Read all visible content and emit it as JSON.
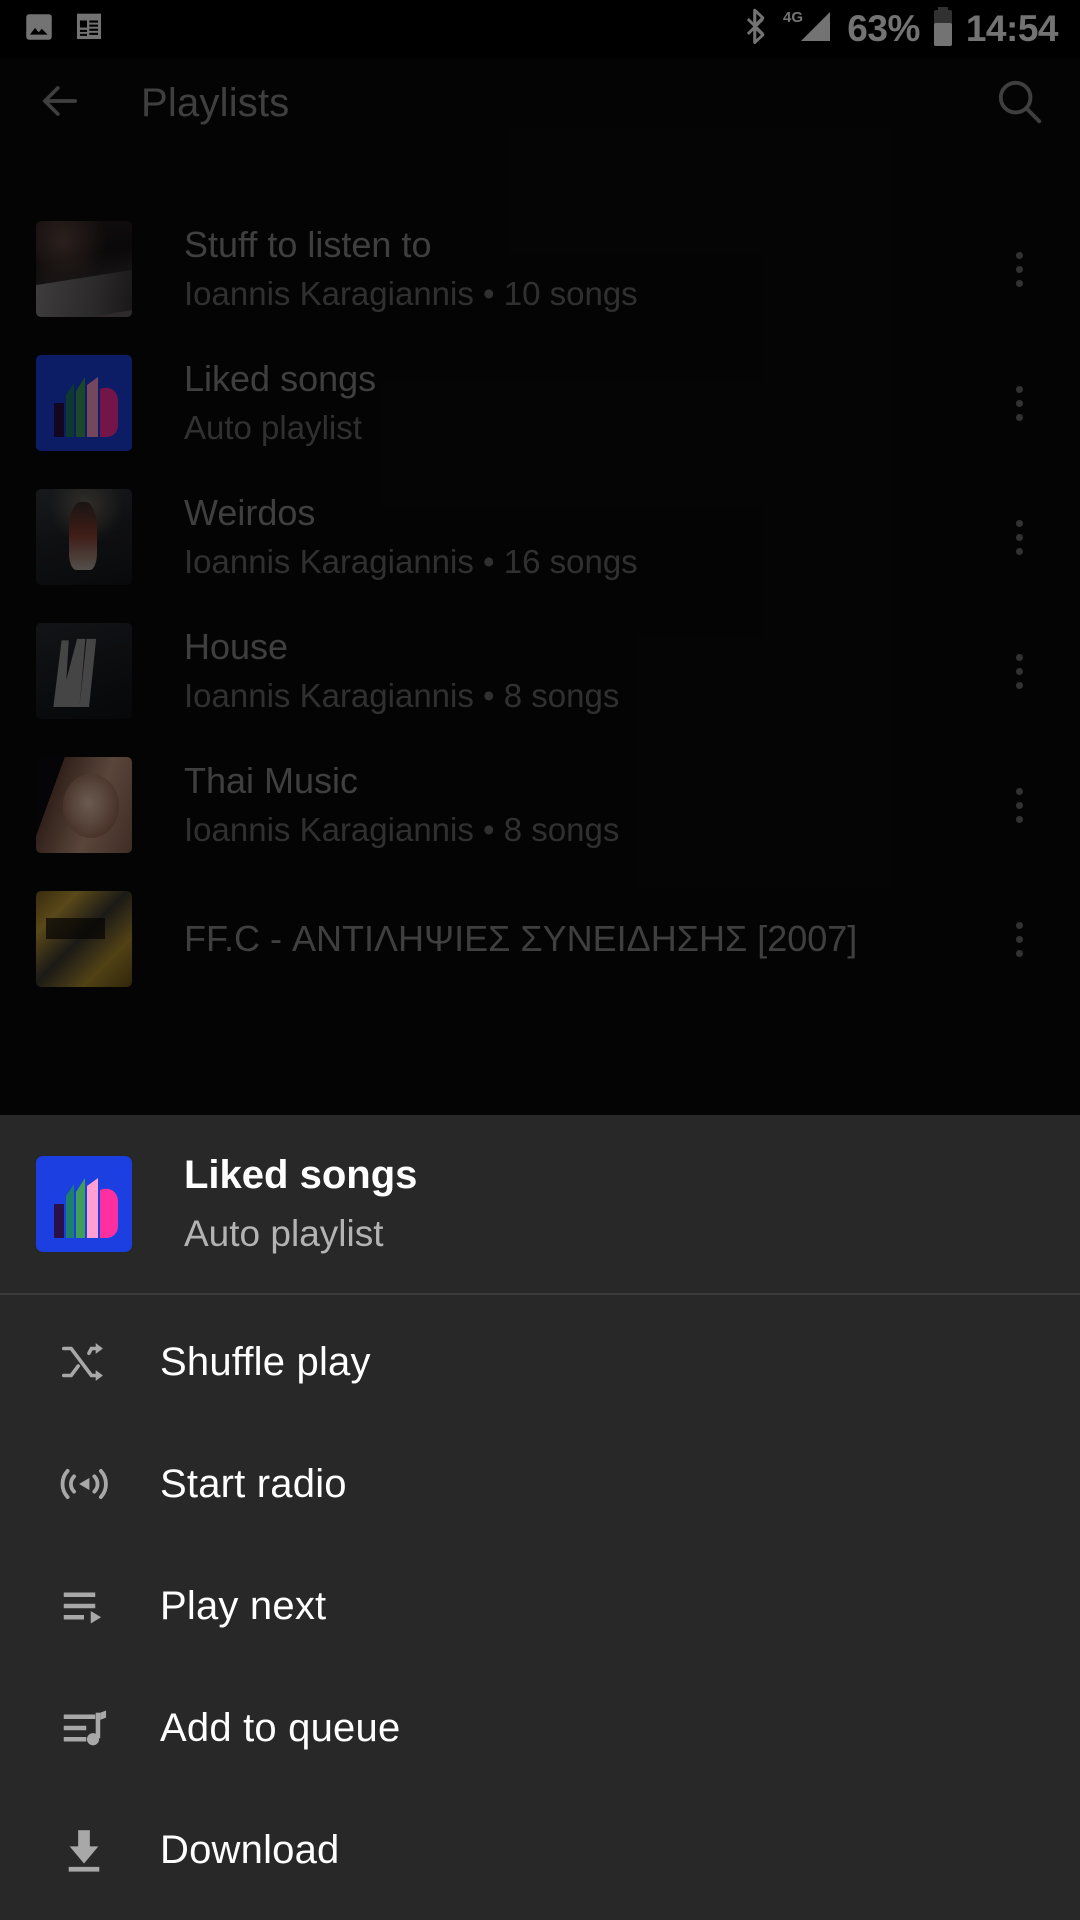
{
  "status_bar": {
    "icons_left": [
      "image-icon",
      "notes-icon"
    ],
    "icons_right": [
      "bluetooth-icon",
      "signal-4g-icon",
      "battery-icon"
    ],
    "network_label": "4G",
    "battery_percent": "63%",
    "time": "14:54"
  },
  "toolbar": {
    "back_icon": "arrow-back-icon",
    "title": "Playlists",
    "search_icon": "search-icon"
  },
  "playlists": [
    {
      "title": "Stuff to listen to",
      "subtitle": "Ioannis Karagiannis • 10 songs",
      "owner": "Ioannis Karagiannis",
      "song_count": "10 songs",
      "thumb_class": "tn-stuff",
      "overflow_icon": "more-vertical-icon"
    },
    {
      "title": "Liked songs",
      "subtitle": "Auto playlist",
      "owner": "",
      "song_count": "",
      "thumb_class": "tn-liked",
      "overflow_icon": "more-vertical-icon"
    },
    {
      "title": "Weirdos",
      "subtitle": "Ioannis Karagiannis • 16 songs",
      "owner": "Ioannis Karagiannis",
      "song_count": "16 songs",
      "thumb_class": "tn-weirdos",
      "overflow_icon": "more-vertical-icon"
    },
    {
      "title": "House",
      "subtitle": "Ioannis Karagiannis • 8 songs",
      "owner": "Ioannis Karagiannis",
      "song_count": "8 songs",
      "thumb_class": "tn-house",
      "overflow_icon": "more-vertical-icon"
    },
    {
      "title": "Thai Music",
      "subtitle": "Ioannis Karagiannis • 8 songs",
      "owner": "Ioannis Karagiannis",
      "song_count": "8 songs",
      "thumb_class": "tn-thai",
      "overflow_icon": "more-vertical-icon"
    },
    {
      "title": "FF.C - ΑΝΤΙΛΗΨΙΕΣ ΣΥΝΕΙΔΗΣΗΣ [2007]",
      "subtitle": "",
      "owner": "",
      "song_count": "",
      "thumb_class": "tn-ffc",
      "overflow_icon": "more-vertical-icon"
    }
  ],
  "sheet": {
    "header": {
      "title": "Liked songs",
      "subtitle": "Auto playlist",
      "thumb_class": "tn-liked"
    },
    "items": [
      {
        "label": "Shuffle play",
        "icon": "shuffle-icon"
      },
      {
        "label": "Start radio",
        "icon": "radio-broadcast-icon"
      },
      {
        "label": "Play next",
        "icon": "play-next-icon"
      },
      {
        "label": "Add to queue",
        "icon": "add-to-queue-icon"
      },
      {
        "label": "Download",
        "icon": "download-icon"
      }
    ]
  },
  "colors": {
    "background": "#0b0b0b",
    "sheet_background": "#282828",
    "accent_blue": "#1b3fe0",
    "primary_text": "#ffffff",
    "secondary_text": "#b3b3b3",
    "dimmed_title": "#8c8c8c",
    "dimmed_sub": "#6b6b6b",
    "icon_grey": "#a8a8a8",
    "divider": "#3b3b3b"
  }
}
